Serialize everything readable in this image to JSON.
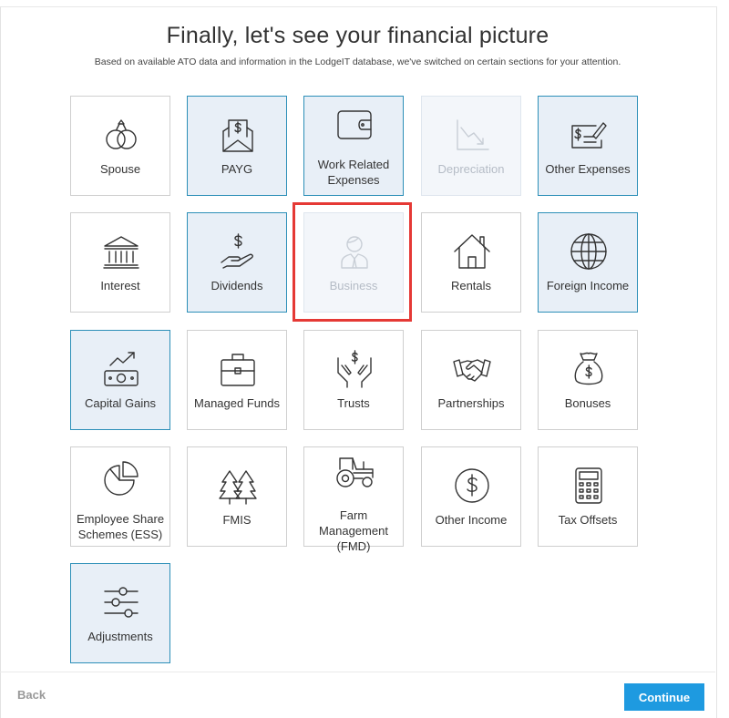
{
  "header": {
    "title": "Finally, let's see your financial picture",
    "subtitle": "Based on available ATO data and information in the LodgeIT database, we've switched on certain sections for your attention."
  },
  "tiles": [
    {
      "label": "Spouse",
      "icon": "rings-icon",
      "state": "default"
    },
    {
      "label": "PAYG",
      "icon": "payslip-envelope-icon",
      "state": "selected"
    },
    {
      "label": "Work Related Expenses",
      "icon": "wallet-icon",
      "state": "selected"
    },
    {
      "label": "Depreciation",
      "icon": "declining-chart-icon",
      "state": "disabled"
    },
    {
      "label": "Other Expenses",
      "icon": "cheque-pen-icon",
      "state": "selected"
    },
    {
      "label": "Interest",
      "icon": "bank-icon",
      "state": "default"
    },
    {
      "label": "Dividends",
      "icon": "hand-dollar-icon",
      "state": "selected"
    },
    {
      "label": "Business",
      "icon": "businessperson-icon",
      "state": "disabled"
    },
    {
      "label": "Rentals",
      "icon": "house-icon",
      "state": "default"
    },
    {
      "label": "Foreign Income",
      "icon": "globe-icon",
      "state": "selected"
    },
    {
      "label": "Capital Gains",
      "icon": "growth-banknote-icon",
      "state": "selected"
    },
    {
      "label": "Managed Funds",
      "icon": "briefcase-icon",
      "state": "default"
    },
    {
      "label": "Trusts",
      "icon": "hands-dollar-icon",
      "state": "default"
    },
    {
      "label": "Partnerships",
      "icon": "handshake-icon",
      "state": "default"
    },
    {
      "label": "Bonuses",
      "icon": "money-bag-icon",
      "state": "default"
    },
    {
      "label": "Employee Share Schemes (ESS)",
      "icon": "pie-chart-icon",
      "state": "default"
    },
    {
      "label": "FMIS",
      "icon": "trees-icon",
      "state": "default"
    },
    {
      "label": "Farm Management (FMD)",
      "icon": "tractor-icon",
      "state": "default"
    },
    {
      "label": "Other Income",
      "icon": "dollar-coin-icon",
      "state": "default"
    },
    {
      "label": "Tax Offsets",
      "icon": "calculator-icon",
      "state": "default"
    },
    {
      "label": "Adjustments",
      "icon": "sliders-icon",
      "state": "selected"
    }
  ],
  "footer": {
    "back_label": "Back",
    "continue_label": "Continue"
  }
}
